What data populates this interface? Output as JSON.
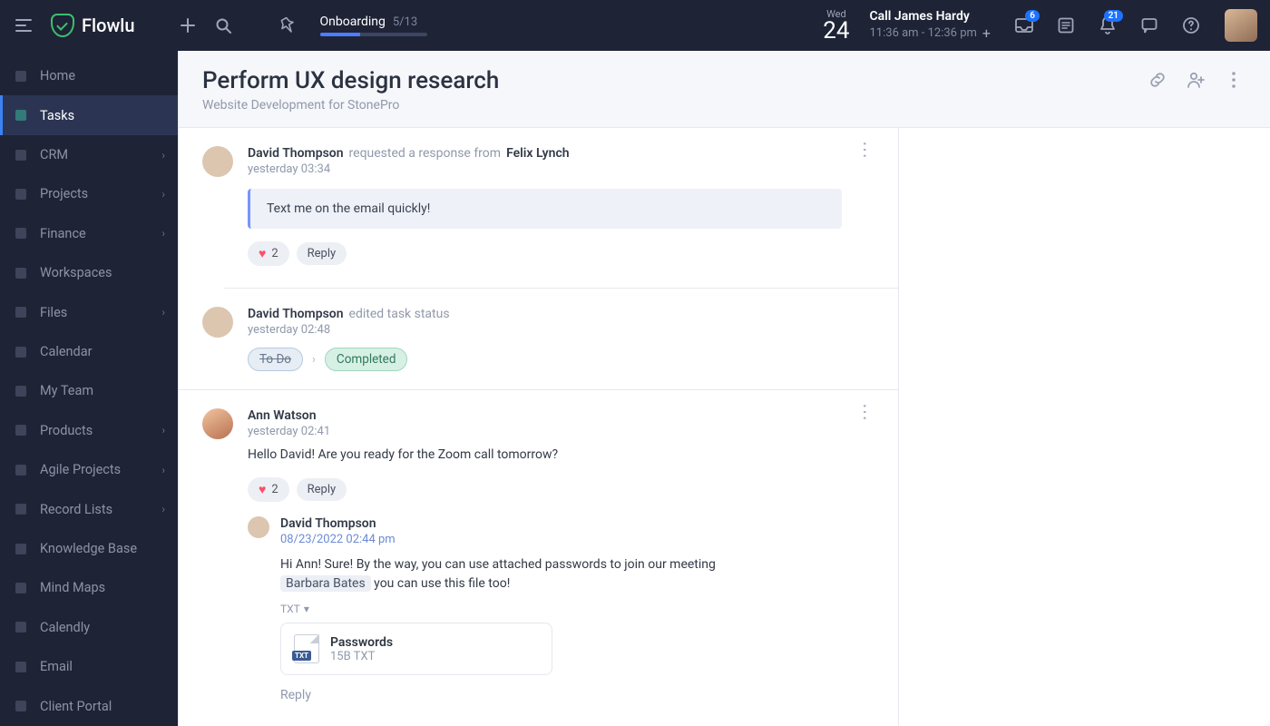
{
  "brand": "Flowlu",
  "topbar": {
    "onboarding": {
      "label": "Onboarding",
      "count": "5/13"
    },
    "date": {
      "dow": "Wed",
      "day": "24"
    },
    "event": {
      "title": "Call James Hardy",
      "time": "11:36 am - 12:36 pm"
    },
    "badges": {
      "inbox": "6",
      "bell": "21"
    }
  },
  "sidebar": [
    {
      "label": "Home",
      "icon": "home",
      "chev": false
    },
    {
      "label": "Tasks",
      "icon": "tasks",
      "chev": false,
      "active": true
    },
    {
      "label": "CRM",
      "icon": "crm",
      "chev": true
    },
    {
      "label": "Projects",
      "icon": "projects",
      "chev": true
    },
    {
      "label": "Finance",
      "icon": "finance",
      "chev": true
    },
    {
      "label": "Workspaces",
      "icon": "workspaces",
      "chev": false
    },
    {
      "label": "Files",
      "icon": "files",
      "chev": true
    },
    {
      "label": "Calendar",
      "icon": "calendar",
      "chev": false
    },
    {
      "label": "My Team",
      "icon": "team",
      "chev": false
    },
    {
      "label": "Products",
      "icon": "products",
      "chev": true
    },
    {
      "label": "Agile Projects",
      "icon": "agile",
      "chev": true
    },
    {
      "label": "Record Lists",
      "icon": "records",
      "chev": true
    },
    {
      "label": "Knowledge Base",
      "icon": "kb",
      "chev": false
    },
    {
      "label": "Mind Maps",
      "icon": "mind",
      "chev": false
    },
    {
      "label": "Calendly",
      "icon": "calendly",
      "chev": false
    },
    {
      "label": "Email",
      "icon": "email",
      "chev": false
    },
    {
      "label": "Client Portal",
      "icon": "portal",
      "chev": false
    }
  ],
  "page": {
    "title": "Perform UX design research",
    "subtitle": "Website Development for StonePro"
  },
  "feed": [
    {
      "type": "request",
      "author": "David Thompson",
      "action": "requested a response from",
      "target": "Felix Lynch",
      "time": "yesterday 03:34",
      "quote": "Text me on the email quickly!",
      "reactions": {
        "hearts": "2",
        "reply": "Reply"
      }
    },
    {
      "type": "status",
      "author": "David Thompson",
      "action": "edited task status",
      "time": "yesterday 02:48",
      "from": "To Do",
      "to": "Completed"
    },
    {
      "type": "comment",
      "author": "Ann Watson",
      "time": "yesterday 02:41",
      "text": "Hello David! Are you ready for the Zoom call tomorrow?",
      "reactions": {
        "hearts": "2",
        "reply": "Reply"
      },
      "reply": {
        "author": "David Thompson",
        "time": "08/23/2022 02:44 pm",
        "text_a": "Hi Ann! Sure! By the way, you can use attached passwords to join our meeting",
        "mention": "Barbara Bates",
        "text_b": " you can use this file too!",
        "attach_label": "TXT",
        "file": {
          "name": "Passwords",
          "meta": "15B TXT"
        },
        "reply_link": "Reply"
      }
    }
  ]
}
